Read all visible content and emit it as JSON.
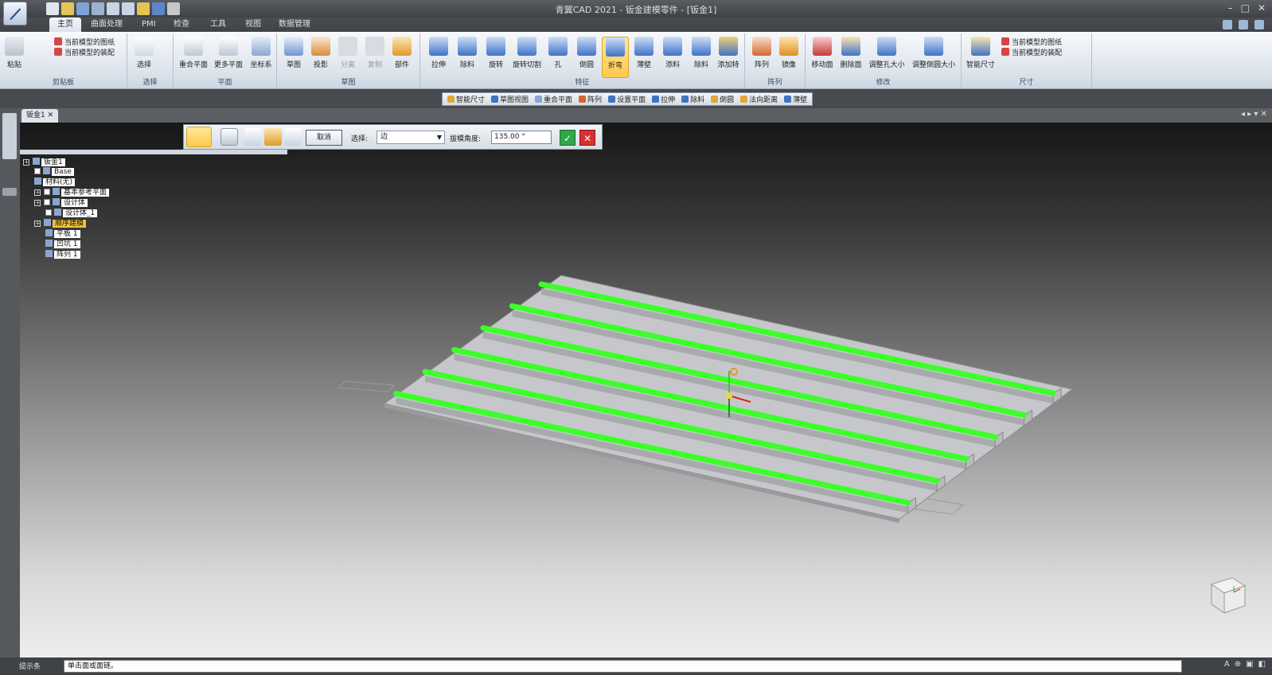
{
  "window": {
    "title": "青翼CAD 2021 - 钣金建模零件 - [钣金1]"
  },
  "ribbon_tabs": [
    "主页",
    "曲面处理",
    "PMI",
    "检查",
    "工具",
    "视图",
    "数据管理"
  ],
  "ribbon": {
    "clipboard": {
      "label": "剪贴板",
      "paste": "粘贴",
      "lines": [
        "当前模型的图纸",
        "当前模型的装配"
      ]
    },
    "select": {
      "label": "选择",
      "btn": "选择"
    },
    "planes": {
      "label": "平面",
      "btns": [
        "重合平面",
        "更多平面",
        "坐标系"
      ]
    },
    "sketch": {
      "label": "草图",
      "btns": [
        "草图",
        "投影",
        "分离",
        "复制",
        "部件"
      ]
    },
    "features": {
      "label": "特征",
      "btns": [
        "拉伸",
        "除料",
        "旋转",
        "旋转切割",
        "孔",
        "倒圆",
        "折弯",
        "薄壁",
        "添料",
        "除料",
        "添加特"
      ]
    },
    "pattern": {
      "label": "阵列",
      "btns": [
        "阵列",
        "镜像"
      ]
    },
    "modify": {
      "label": "修改",
      "btns": [
        "移动面",
        "删除面",
        "调整孔大小",
        "调整倒圆大小"
      ]
    },
    "dimension": {
      "label": "尺寸",
      "btn": "智能尺寸",
      "lines": [
        "当前模型的图纸",
        "当前模型的装配"
      ]
    }
  },
  "command_bar": [
    "智能尺寸",
    "草图视图",
    "重合平面",
    "阵列",
    "设置平面",
    "拉伸",
    "除料",
    "倒圆",
    "法向距离",
    "薄壁"
  ],
  "doc_tab": "钣金1",
  "feature_bar": {
    "cancel": "取消",
    "select_label": "选择:",
    "select_value": "边",
    "angle_label": "拔模角度:",
    "angle_value": "135.00 °",
    "ok": "✓",
    "close": "✕"
  },
  "tree": [
    {
      "label": "钣金1",
      "level": 0
    },
    {
      "label": "Base",
      "level": 1
    },
    {
      "label": "材料(无)",
      "level": 1
    },
    {
      "label": "基本参考平面",
      "level": 1
    },
    {
      "label": "设计体",
      "level": 1
    },
    {
      "label": "设计体_1",
      "level": 2
    },
    {
      "label": "顺序建模",
      "level": 1
    },
    {
      "label": "平板 1",
      "level": 2
    },
    {
      "label": "凹坑 1",
      "level": 2
    },
    {
      "label": "阵列 1",
      "level": 2
    }
  ],
  "status": {
    "label": "提示条",
    "text": "单击面或面链。"
  },
  "colors": {
    "highlight_green": "#3cff2a",
    "plate_top": "#c8c8cc",
    "accent": "#f2c23e"
  }
}
